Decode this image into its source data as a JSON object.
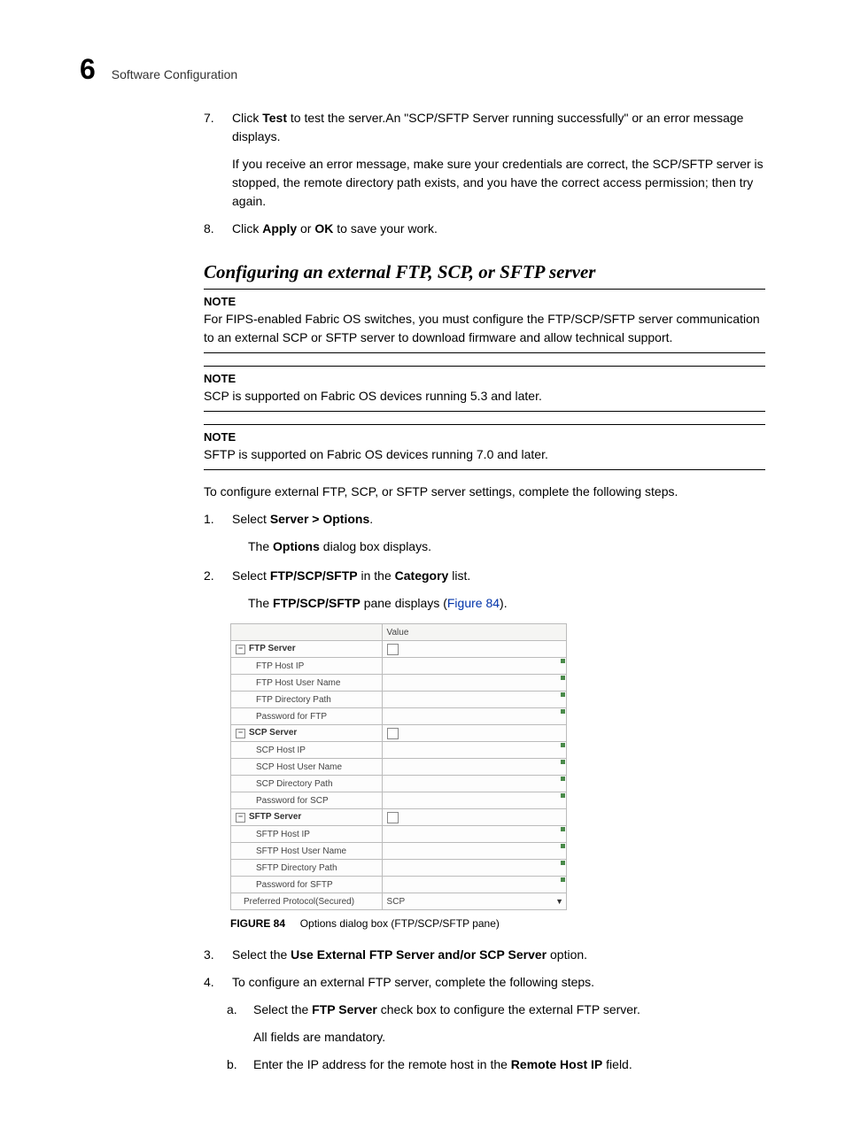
{
  "header": {
    "chapter_number": "6",
    "chapter_title": "Software Configuration"
  },
  "steps_top": {
    "s7": {
      "num": "7.",
      "text_a": "Click ",
      "bold1": "Test",
      "text_b": " to test the server.An \"SCP/SFTP Server running successfully\" or an error message displays.",
      "para2": "If you receive an error message, make sure your credentials are correct, the SCP/SFTP server is stopped, the remote directory path exists, and you have the correct access permission; then try again."
    },
    "s8": {
      "num": "8.",
      "text_a": "Click ",
      "bold1": "Apply",
      "text_b": " or ",
      "bold2": "OK",
      "text_c": " to save your work."
    }
  },
  "section_heading": "Configuring an external FTP, SCP, or SFTP server",
  "notes": {
    "note_label": "NOTE",
    "n1": "For FIPS-enabled Fabric OS switches, you must configure the FTP/SCP/SFTP server communication to an external SCP or SFTP server to download firmware and allow technical support.",
    "n2": "SCP is supported on Fabric OS devices running 5.3 and later.",
    "n3": "SFTP is supported on Fabric OS devices running 7.0 and later."
  },
  "intro_para": "To configure external FTP, SCP, or SFTP server settings, complete the following steps.",
  "steps_main": {
    "s1": {
      "num": "1.",
      "text_a": "Select ",
      "bold1": "Server > Options",
      "text_b": ".",
      "sub_a": "The ",
      "sub_bold": "Options",
      "sub_b": " dialog box displays."
    },
    "s2": {
      "num": "2.",
      "text_a": "Select ",
      "bold1": "FTP/SCP/SFTP",
      "text_b": " in the ",
      "bold2": "Category",
      "text_c": " list.",
      "sub_a": "The ",
      "sub_bold": "FTP/SCP/SFTP",
      "sub_b": " pane displays (",
      "sub_link": "Figure 84",
      "sub_c": ")."
    },
    "s3": {
      "num": "3.",
      "text_a": "Select the ",
      "bold1": "Use External FTP Server and/or SCP Server",
      "text_b": " option."
    },
    "s4": {
      "num": "4.",
      "text_a": "To configure an external FTP server, complete the following steps.",
      "a": {
        "letter": "a.",
        "t1": "Select the ",
        "b1": "FTP Server",
        "t2": " check box to configure the external FTP server.",
        "sub": "All fields are mandatory."
      },
      "b": {
        "letter": "b.",
        "t1": "Enter the IP address for the remote host in the ",
        "b1": "Remote Host IP",
        "t2": " field."
      }
    }
  },
  "figure": {
    "value_header": "Value",
    "ftp": {
      "section": "FTP Server",
      "rows": [
        "FTP Host IP",
        "FTP Host User Name",
        "FTP Directory Path",
        "Password for FTP"
      ]
    },
    "scp": {
      "section": "SCP Server",
      "rows": [
        "SCP Host IP",
        "SCP Host User Name",
        "SCP Directory Path",
        "Password for SCP"
      ]
    },
    "sftp": {
      "section": "SFTP Server",
      "rows": [
        "SFTP Host IP",
        "SFTP Host User Name",
        "SFTP Directory Path",
        "Password for SFTP"
      ]
    },
    "preferred": {
      "label": "Preferred Protocol(Secured)",
      "value": "SCP"
    },
    "caption_num": "FIGURE 84",
    "caption_text": "Options dialog box (FTP/SCP/SFTP pane)"
  }
}
